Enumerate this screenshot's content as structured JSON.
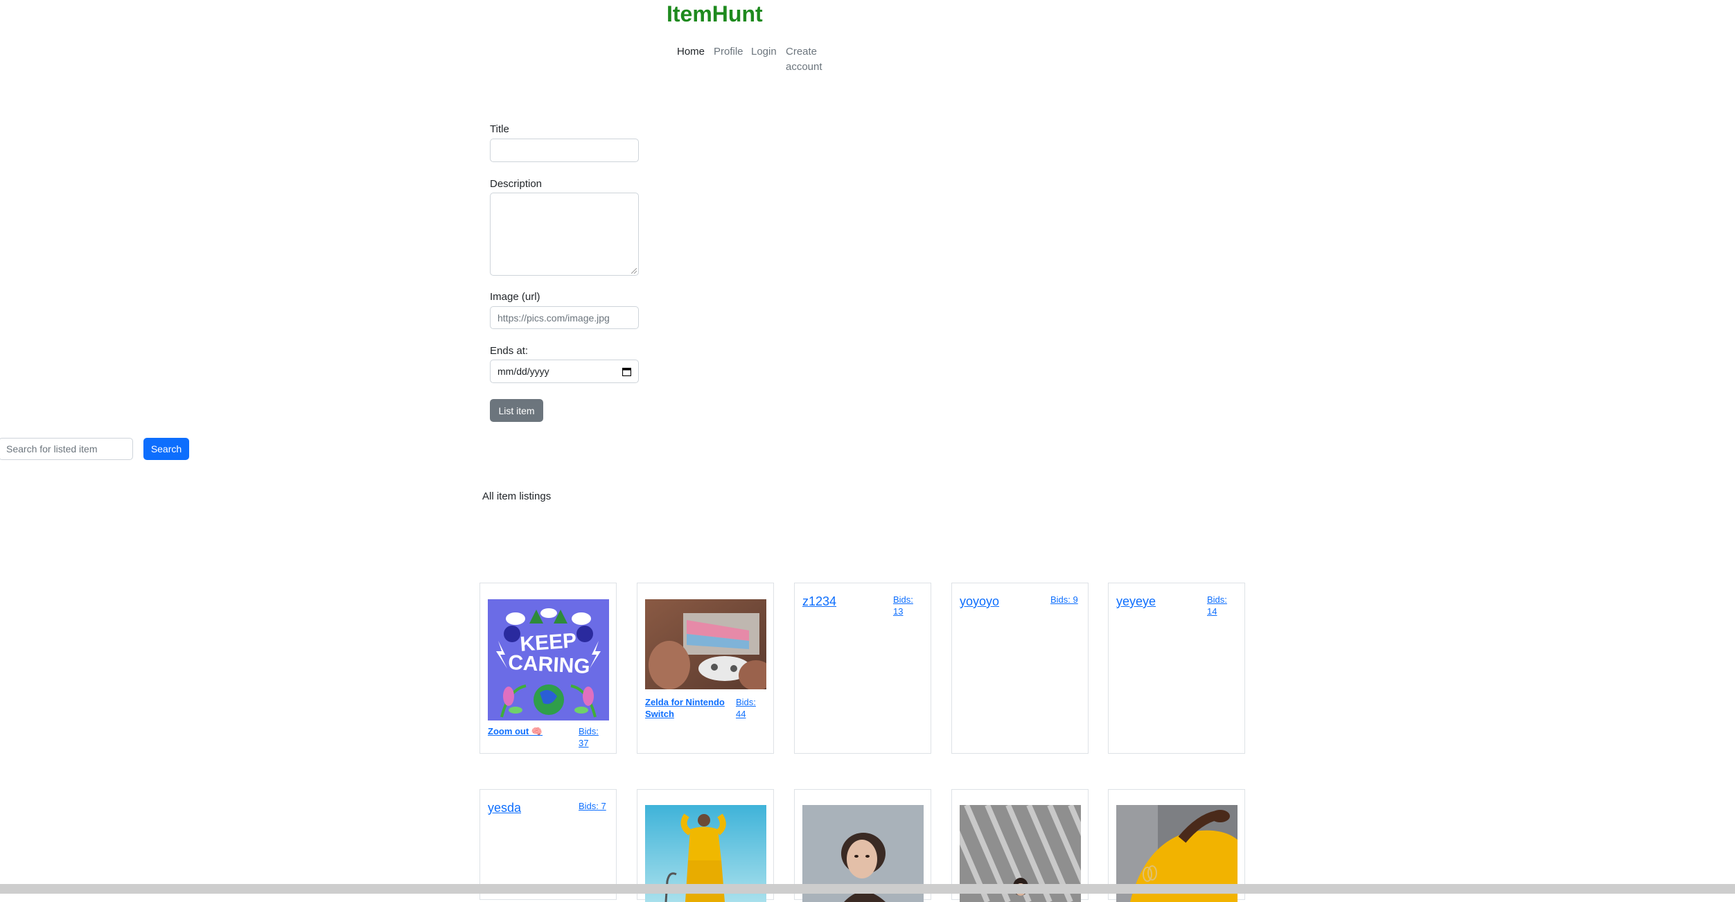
{
  "app": {
    "brand": "ItemHunt"
  },
  "nav": {
    "home": "Home",
    "profile": "Profile",
    "login": "Login",
    "create_account_line1": "Create",
    "create_account_line2": "account"
  },
  "form": {
    "title_label": "Title",
    "description_label": "Description",
    "image_label": "Image (url)",
    "image_placeholder": "https://pics.com/image.jpg",
    "ends_label": "Ends at:",
    "ends_placeholder": "mm/dd/yyyy",
    "submit_label": "List item"
  },
  "search": {
    "placeholder": "Search for listed item",
    "button_label": "Search"
  },
  "listings": {
    "heading": "All item listings",
    "row1": [
      {
        "title": "Zoom out 🧠",
        "bids": "Bids: 37",
        "image": "keep-caring-poster"
      },
      {
        "title": "Zelda for Nintendo Switch",
        "bids": "Bids: 44",
        "image": "game-controller-photo"
      },
      {
        "title": "z1234",
        "bids": "Bids: 13"
      },
      {
        "title": "yoyoyo",
        "bids": "Bids: 9"
      },
      {
        "title": "yeyeye",
        "bids": "Bids: 14"
      }
    ],
    "row2": [
      {
        "title": "yesda",
        "bids": "Bids: 7"
      },
      {
        "image": "yellow-outfit-photo"
      },
      {
        "image": "woman-portrait-photo"
      },
      {
        "image": "striped-shadow-photo"
      },
      {
        "image": "yellow-sleeve-photo"
      }
    ]
  },
  "colors": {
    "brand": "#1e8a1e",
    "link": "#0d6efd",
    "primary_button": "#0d6efd",
    "secondary_button": "#6c757d"
  }
}
